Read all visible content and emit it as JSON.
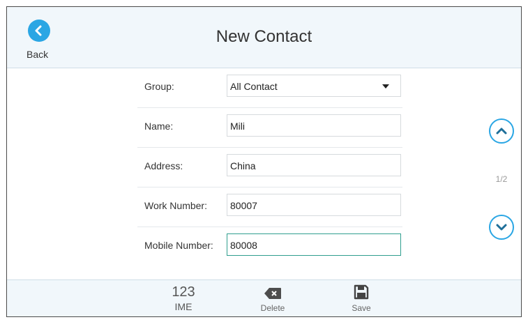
{
  "header": {
    "title": "New Contact",
    "back_label": "Back"
  },
  "form": {
    "rows": [
      {
        "label": "Group:",
        "value": "All Contact"
      },
      {
        "label": "Name:",
        "value": "Mili"
      },
      {
        "label": "Address:",
        "value": "China"
      },
      {
        "label": "Work Number:",
        "value": "80007"
      },
      {
        "label": "Mobile Number:",
        "value": "80008"
      }
    ]
  },
  "pagination": {
    "indicator": "1/2"
  },
  "footer": {
    "ime_top": "123",
    "ime_bottom": "IME",
    "delete_label": "Delete",
    "save_label": "Save"
  },
  "colors": {
    "accent": "#2aa6e4",
    "header_bg": "#f1f7fb",
    "active_border": "#2f9e8e"
  }
}
